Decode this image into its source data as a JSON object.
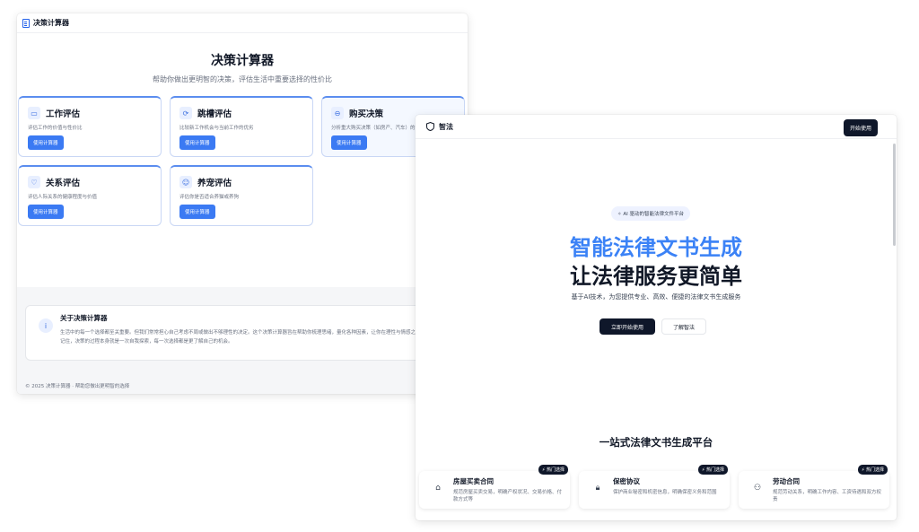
{
  "left_app": {
    "header_title": "决策计算器",
    "title": "决策计算器",
    "subtitle": "帮助你做出更明智的决策，评估生活中重要选择的性价比",
    "cards": [
      {
        "title": "工作评估",
        "icon": "briefcase-icon",
        "glyph": "▭",
        "desc": "评估工作的价值与性价比",
        "button": "使用计算器"
      },
      {
        "title": "跳槽评估",
        "icon": "refresh-icon",
        "glyph": "⟳",
        "desc": "比较新工作机会与当前工作的优劣",
        "button": "使用计算器"
      },
      {
        "title": "购买决策",
        "icon": "car-icon",
        "glyph": "⊖",
        "desc": "分析重大购买决策（如房产、汽车）的",
        "button": "使用计算器"
      },
      {
        "title": "关系评估",
        "icon": "heart-icon",
        "glyph": "♡",
        "desc": "评估人际关系的健康程度与价值",
        "button": "使用计算器"
      },
      {
        "title": "养宠评估",
        "icon": "pet-icon",
        "glyph": "☺",
        "desc": "评估你是否适合养猫或养狗",
        "button": "使用计算器"
      }
    ],
    "about": {
      "title": "关于决策计算器",
      "text": "生活中的每一个选择都至关重要。但我们常常担心自己考虑不周或做出不够理性的决定。这个决策计算器旨在帮助你梳理思绪，量化各种因素，让你在理性与情感之间找到平衡。记住，决策的过程本身就是一次自我探索，每一次选择都是更了解自己的机会。"
    },
    "footer": "© 2025 决策计算器 · 帮助您做出更明智的选择"
  },
  "right_app": {
    "brand": "智法",
    "start_button": "开始使用",
    "badge": "AI 驱动的智能法律文件平台",
    "hero_line1": "智能法律文书生成",
    "hero_line2": "让法律服务更简单",
    "hero_sub": "基于AI技术，为您提供专业、高效、便捷的法律文书生成服务",
    "primary_cta": "立即开始使用",
    "secondary_cta": "了解智法",
    "section_title": "一站式法律文书生成平台",
    "docs": [
      {
        "title": "房屋买卖合同",
        "icon": "house-icon",
        "glyph": "⌂",
        "desc": "规范房屋买卖交易，明确产权状况、交易价格、付款方式等",
        "tag": "热门选择"
      },
      {
        "title": "保密协议",
        "icon": "lock-icon",
        "glyph": "🔒︎",
        "desc": "保护商业秘密和机密信息，明确保密义务和范围",
        "tag": "热门选择"
      },
      {
        "title": "劳动合同",
        "icon": "users-icon",
        "glyph": "⚇",
        "desc": "规范劳动关系，明确工作内容、工资待遇和双方权责",
        "tag": "热门选择"
      }
    ]
  }
}
